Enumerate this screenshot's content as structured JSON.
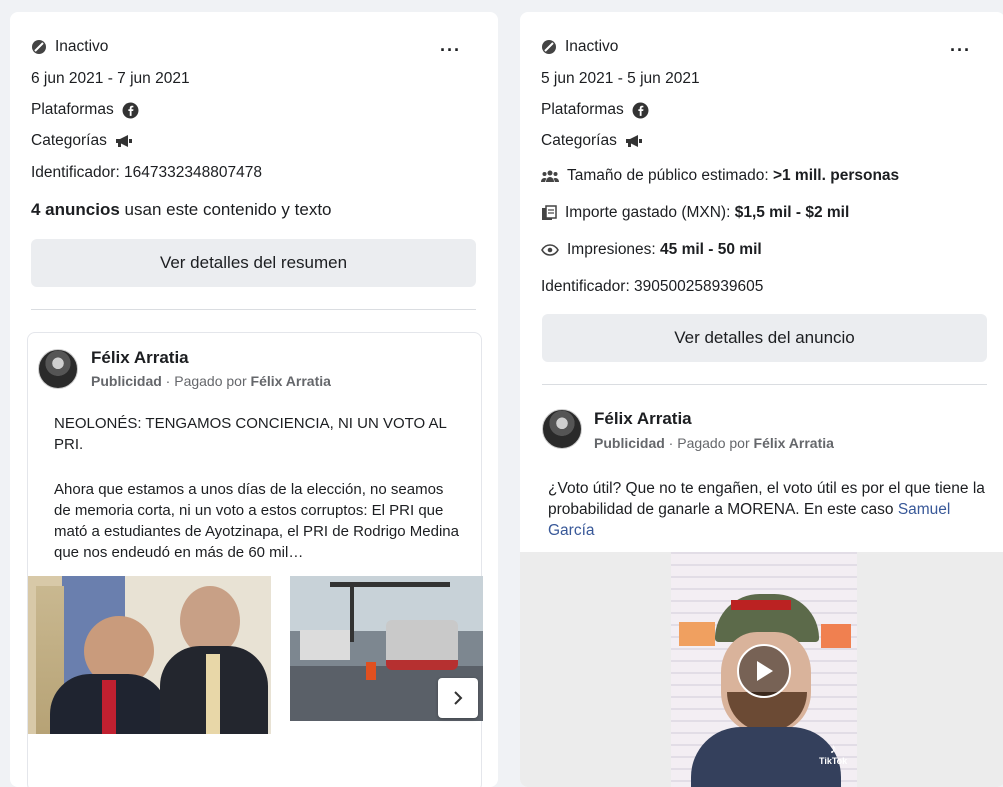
{
  "left": {
    "status": "Inactivo",
    "dates": "6 jun 2021 - 7 jun 2021",
    "platforms_label": "Plataformas",
    "categories_label": "Categorías",
    "identifier": "Identificador: 1647332348807478",
    "count_bold": "4 anuncios",
    "count_rest": " usan este contenido y texto",
    "button": "Ver detalles del resumen",
    "ad": {
      "advertiser": "Félix Arratia",
      "publicidad": "Publicidad",
      "paid_by": " · Pagado por ",
      "payer": "Félix Arratia",
      "text1": "NEOLONÉS: TENGAMOS CONCIENCIA, NI UN VOTO AL PRI.",
      "text2": "Ahora que estamos a unos días de la elección, no seamos de memoria corta, ni un voto a estos corruptos: El PRI que mató a estudiantes de Ayotzinapa, el PRI de Rodrigo Medina que nos endeudó en más de 60 mil…"
    }
  },
  "right": {
    "status": "Inactivo",
    "dates": "5 jun 2021 - 5 jun 2021",
    "platforms_label": "Plataformas",
    "categories_label": "Categorías",
    "audience_label": "Tamaño de público estimado: ",
    "audience_value": ">1 mill. personas",
    "spend_label": "Importe gastado (MXN): ",
    "spend_value": "$1,5 mil - $2 mil",
    "impressions_label": "Impresiones: ",
    "impressions_value": "45 mil - 50 mil",
    "identifier": "Identificador: 390500258939605",
    "button": "Ver detalles del anuncio",
    "ad": {
      "advertiser": "Félix Arratia",
      "publicidad": "Publicidad",
      "paid_by": " · Pagado por ",
      "payer": "Félix Arratia",
      "text": "¿Voto útil? Que no te engañen, el voto útil es por el que tiene la probabilidad de ganarle a MORENA. En este caso ",
      "link": "Samuel García",
      "video_brand": "TikTok"
    }
  },
  "colors": {
    "link": "#385898",
    "button_bg": "#ebedf0",
    "muted": "#65676b"
  }
}
